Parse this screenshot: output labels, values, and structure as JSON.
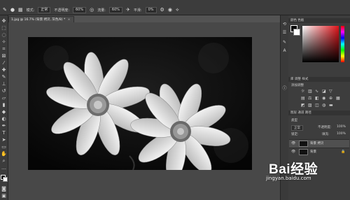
{
  "options_bar": {
    "mode_label": "模式:",
    "mode_value": "正常",
    "opacity_label": "不透明度:",
    "opacity_value": "60%",
    "flow_label": "流量:",
    "flow_value": "60%",
    "smoothing_label": "平滑:",
    "smoothing_value": "0%"
  },
  "document_tab": {
    "title": "1.jpg @ 16.7% (背景 拷贝, 灰色/8) *",
    "close": "×"
  },
  "layers_panel": {
    "tabs": "图层   通道   路径",
    "kind_label": "类型",
    "blend_mode": "正常",
    "opacity_label": "不透明度:",
    "opacity_value": "100%",
    "lock_label": "锁定:",
    "fill_label": "填充:",
    "fill_value": "100%",
    "layers": [
      {
        "name": "背景 拷贝",
        "selected": true
      },
      {
        "name": "背景",
        "selected": false
      }
    ]
  },
  "color_panel": {
    "tabs": "颜色   色板",
    "foreground": "#000000",
    "background": "#ffffff",
    "hue": "#e0141a"
  },
  "adjustments_panel": {
    "tabs": "库   调整   样式",
    "add_label": "添加调整"
  },
  "watermark": {
    "logo": "Bai经验",
    "url": "jingyan.baidu.com"
  }
}
